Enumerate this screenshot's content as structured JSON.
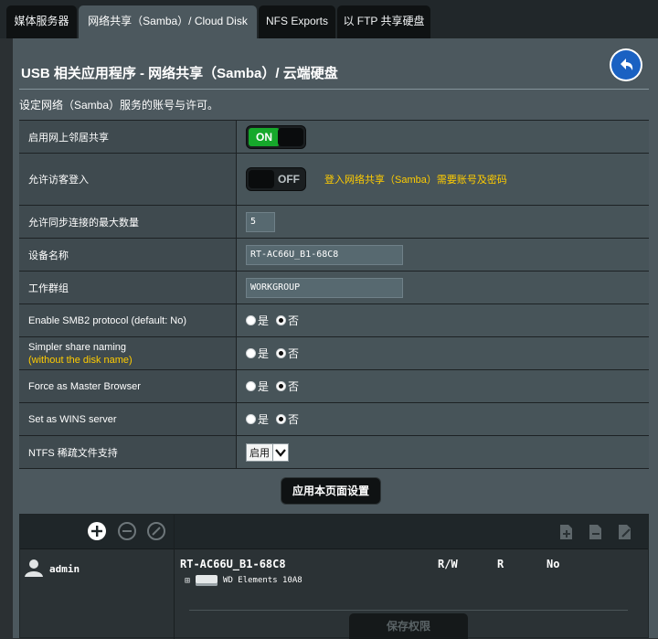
{
  "tabs": [
    {
      "label": "媒体服务器"
    },
    {
      "label": "网络共享（Samba）/ Cloud Disk"
    },
    {
      "label": "NFS Exports"
    },
    {
      "label": "以 FTP 共享硬盘"
    }
  ],
  "page": {
    "title": "USB 相关应用程序 - 网络共享（Samba）/ 云端硬盘",
    "description": "设定网络（Samba）服务的账号与许可。"
  },
  "settings": {
    "network_neighborhood": {
      "label": "启用网上邻居共享",
      "state": "ON"
    },
    "guest_login": {
      "label": "允许访客登入",
      "state": "OFF",
      "hint": "登入网络共享（Samba）需要账号及密码"
    },
    "max_connections": {
      "label": "允许同步连接的最大数量",
      "value": "5"
    },
    "device_name": {
      "label": "设备名称",
      "value": "RT-AC66U_B1-68C8"
    },
    "workgroup": {
      "label": "工作群组",
      "value": "WORKGROUP"
    },
    "smb2": {
      "label": "Enable SMB2 protocol (default: No)"
    },
    "simpler_naming": {
      "label": "Simpler share naming",
      "sublabel": "(without the disk name)"
    },
    "master_browser": {
      "label": "Force as Master Browser"
    },
    "wins": {
      "label": "Set as WINS server"
    },
    "ntfs_sparse": {
      "label": "NTFS 稀疏文件支持",
      "selected": "启用"
    },
    "yes_label": "是",
    "no_label": "否"
  },
  "buttons": {
    "apply": "应用本页面设置",
    "save_permission": "保存权限"
  },
  "accounts": {
    "user": "admin",
    "device": "RT-AC66U_B1-68C8",
    "perm_headers": [
      "R/W",
      "R",
      "No"
    ],
    "disk": "WD Elements 10A8"
  },
  "colors": {
    "panel": "#4c585e",
    "on_green": "#16a82b",
    "hint_yellow": "#ffcc00",
    "back_blue": "#1a61c2"
  }
}
